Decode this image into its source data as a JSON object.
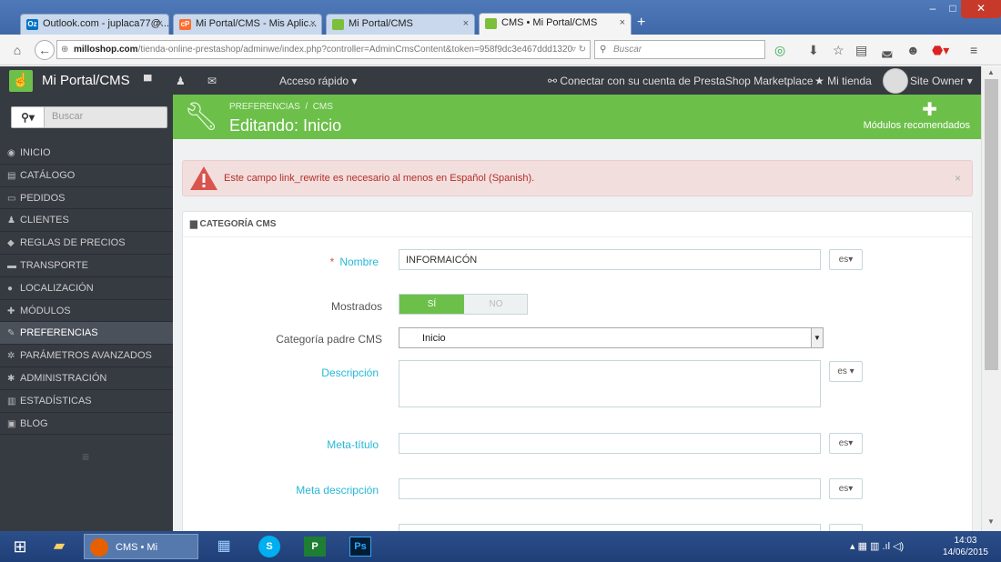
{
  "browser": {
    "tabs": [
      {
        "label": "Outlook.com - juplaca77@...",
        "icon": "Oz",
        "color": "#0072c6"
      },
      {
        "label": "Mi Portal/CMS - Mis Aplic...",
        "icon": "cP",
        "color": "#ff6c2c"
      },
      {
        "label": "Mi Portal/CMS",
        "icon": "▪",
        "color": "#7bbf3a"
      },
      {
        "label": "CMS • Mi Portal/CMS",
        "icon": "▪",
        "color": "#7bbf3a"
      }
    ],
    "close_glyph": "×",
    "url_domain": "milloshop.com",
    "url_path": "/tienda-online-prestashop/adminwe/index.php?controller=AdminCmsContent&token=958f9dc3e467ddd1320",
    "search_placeholder": "Buscar"
  },
  "header": {
    "brand": "Mi Portal/CMS",
    "quick_access": "Acceso rápido",
    "marketplace": "Conectar con su cuenta de PrestaShop Marketplace",
    "my_shop": "Mi tienda",
    "user": "Site Owner"
  },
  "sidebar": {
    "search_placeholder": "Buscar",
    "items": [
      {
        "label": "INICIO",
        "icon": "dashboard-icon",
        "glyph": "◉"
      },
      {
        "label": "CATÁLOGO",
        "icon": "book-icon",
        "glyph": "▤"
      },
      {
        "label": "PEDIDOS",
        "icon": "credit-card-icon",
        "glyph": "▭"
      },
      {
        "label": "CLIENTES",
        "icon": "users-icon",
        "glyph": "♟"
      },
      {
        "label": "REGLAS DE PRECIOS",
        "icon": "tag-icon",
        "glyph": "◆"
      },
      {
        "label": "TRANSPORTE",
        "icon": "truck-icon",
        "glyph": "▬"
      },
      {
        "label": "LOCALIZACIÓN",
        "icon": "globe-icon",
        "glyph": "●"
      },
      {
        "label": "MÓDULOS",
        "icon": "puzzle-icon",
        "glyph": "✚"
      },
      {
        "label": "PREFERENCIAS",
        "icon": "wrench-icon",
        "glyph": "✎"
      },
      {
        "label": "PARÁMETROS AVANZADOS",
        "icon": "cogs-icon",
        "glyph": "✲"
      },
      {
        "label": "ADMINISTRACIÓN",
        "icon": "cog-icon",
        "glyph": "✱"
      },
      {
        "label": "ESTADÍSTICAS",
        "icon": "bar-chart-icon",
        "glyph": "▥"
      },
      {
        "label": "BLOG",
        "icon": "edit-icon",
        "glyph": "▣"
      }
    ],
    "active_index": 8
  },
  "page": {
    "breadcrumb": [
      "PREFERENCIAS",
      "CMS"
    ],
    "title": "Editando: Inicio",
    "recommended_modules": "Módulos recomendados"
  },
  "alert": {
    "text": "Este campo link_rewrite es necesario al menos en Español (Spanish)."
  },
  "form": {
    "panel_title": "CATEGORÍA CMS",
    "name_label": "Nombre",
    "name_value": "INFORMAICÓN",
    "lang": "es",
    "shown_label": "Mostrados",
    "yes": "SÍ",
    "no": "NO",
    "parent_label": "Categoría padre CMS",
    "parent_value": "Inicio",
    "description_label": "Descripción",
    "meta_title_label": "Meta-título",
    "meta_description_label": "Meta descripción"
  },
  "taskbar": {
    "active_window": "CMS • Mi Portal/...",
    "time": "14:03",
    "date": "14/06/2015"
  }
}
